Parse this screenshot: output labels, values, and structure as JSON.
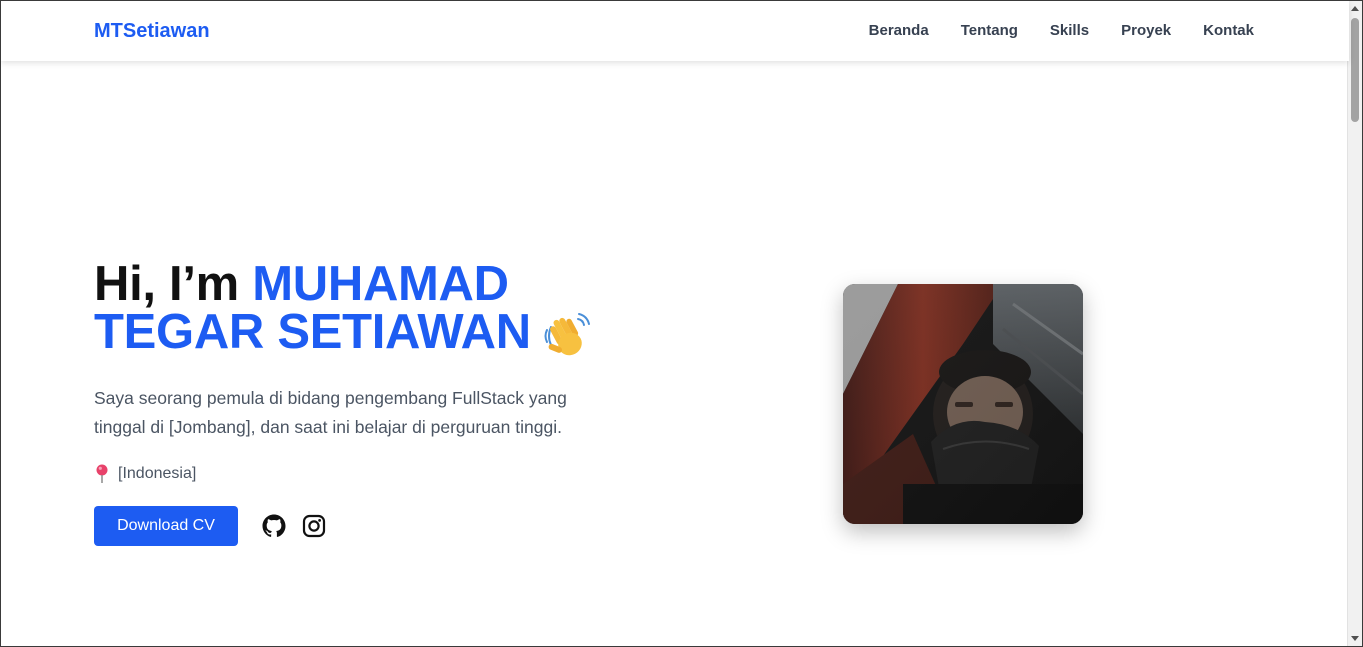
{
  "navbar": {
    "brand": "MTSetiawan",
    "links": [
      "Beranda",
      "Tentang",
      "Skills",
      "Proyek",
      "Kontak"
    ]
  },
  "hero": {
    "greeting": "Hi, I’m ",
    "name_line1": "MUHAMAD",
    "name_line2": "TEGAR SETIAWAN",
    "wave_emoji": "waving-hand-icon",
    "description": "Saya seorang pemula di bidang pengembang FullStack yang tinggal di [Jombang], dan saat ini belajar di perguruan tinggi.",
    "location_icon": "location-pin-icon",
    "location": "[Indonesia]",
    "cv_button": "Download CV",
    "social_icons": [
      "github-icon",
      "instagram-icon"
    ]
  },
  "colors": {
    "accent": "#1d5cf2",
    "heading": "#111111",
    "body_text": "#4b5563",
    "nav_text": "#374151"
  }
}
